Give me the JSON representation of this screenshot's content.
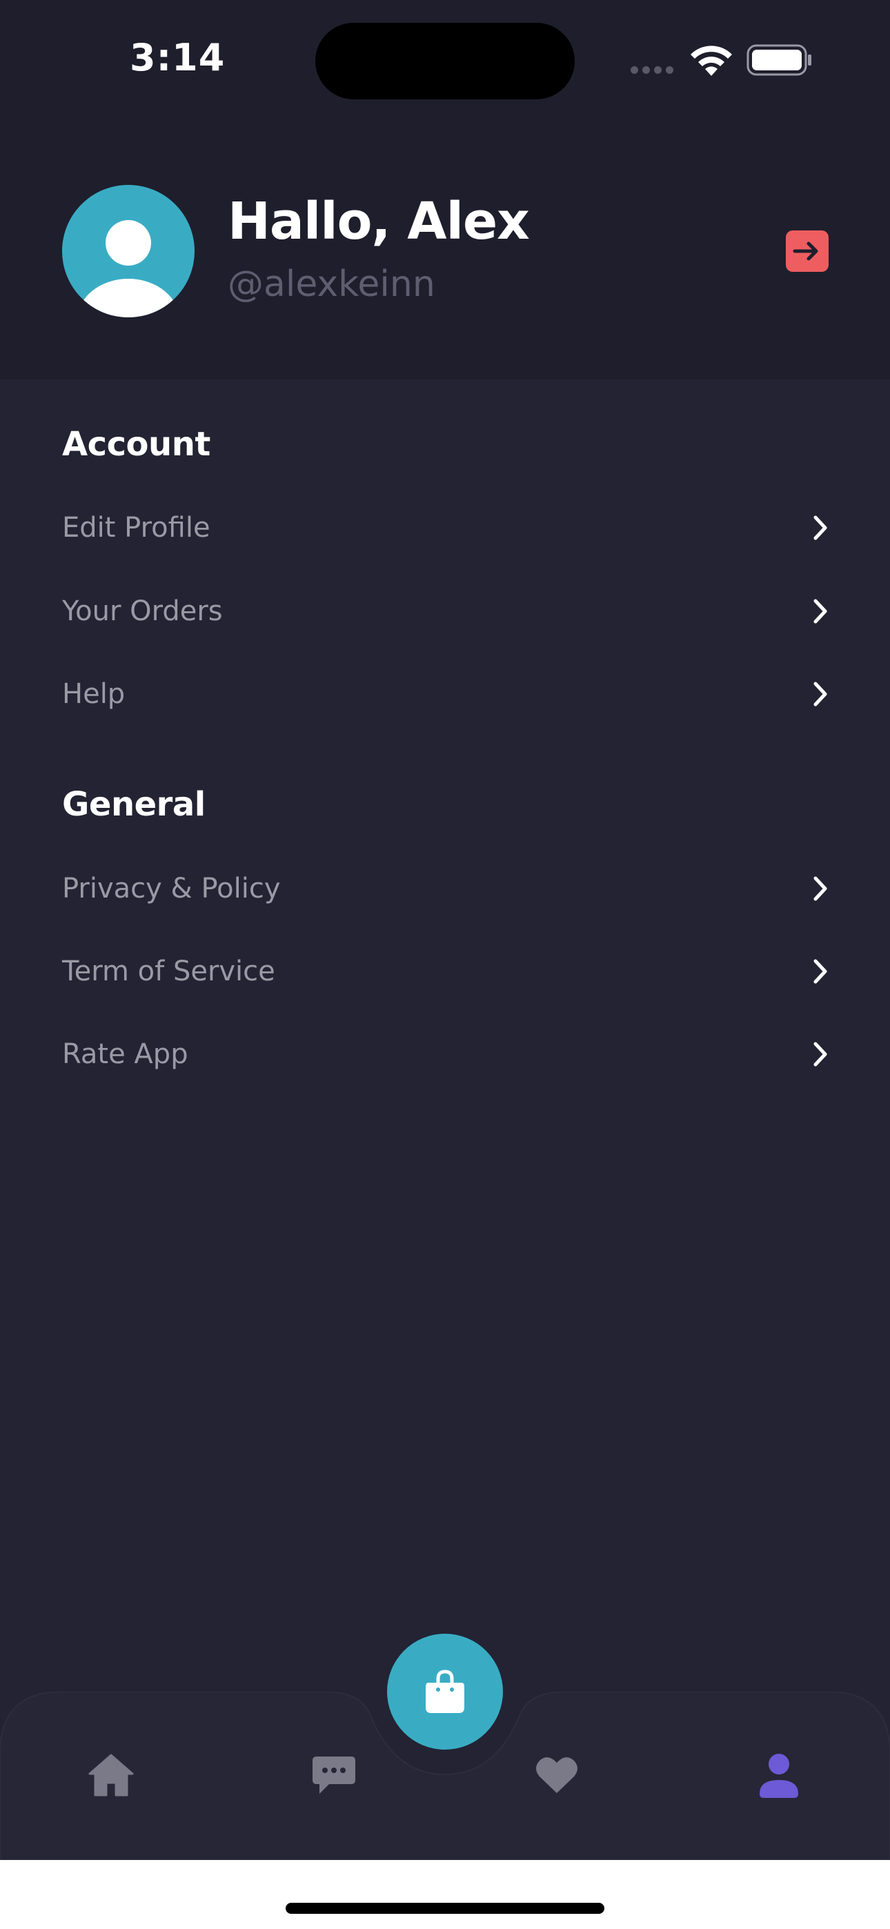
{
  "status_bar": {
    "time": "3:14"
  },
  "profile": {
    "greeting": "Hallo, Alex",
    "handle": "@alexkeinn"
  },
  "sections": {
    "account": {
      "title": "Account",
      "items": [
        {
          "label": "Edit Profile"
        },
        {
          "label": "Your Orders"
        },
        {
          "label": "Help"
        }
      ]
    },
    "general": {
      "title": "General",
      "items": [
        {
          "label": "Privacy & Policy"
        },
        {
          "label": "Term of Service"
        },
        {
          "label": "Rate App"
        }
      ]
    }
  },
  "nav": {
    "items": [
      {
        "icon": "home-icon",
        "active": false
      },
      {
        "icon": "chat-icon",
        "active": false
      },
      {
        "icon": "heart-icon",
        "active": false
      },
      {
        "icon": "profile-icon",
        "active": true
      }
    ],
    "center_icon": "shopping-bag-icon"
  },
  "colors": {
    "accent": "#39acc4",
    "logout": "#ee5e60",
    "active_nav": "#6c5ad6",
    "inactive_nav": "#7a7a88",
    "background": "#232333",
    "header_background": "#1f1e2c"
  }
}
